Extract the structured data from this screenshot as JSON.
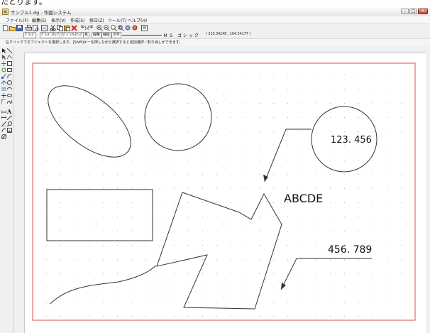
{
  "caption_top": "たとります。",
  "window": {
    "title": "サンプル1.dg - 作図システム"
  },
  "menu": [
    {
      "label": "ファイル(F)"
    },
    {
      "label": "編集(E)"
    },
    {
      "label": "表示(V)"
    },
    {
      "label": "作成(S)"
    },
    {
      "label": "修正(Z)"
    },
    {
      "label": "ツール(T)"
    },
    {
      "label": "ヘルプ(H)"
    }
  ],
  "toolbar2": {
    "grid_button": "ｸﾞﾘｯﾄﾞ",
    "grid_snap_button": "ｸﾞﾘｯﾄﾞｽﾅｯﾌﾟ",
    "object_snap_button": "ｵﾌﾞｼﾞｪｸﾄｽﾅｯﾌﾟ",
    "color_button": "色",
    "line_type_button": "線種",
    "line_width_button": "線幅",
    "text_button": "文字",
    "font_name": "ＭＳ ゴシック",
    "coords": "( 310.34248 , 164.54177 )"
  },
  "status": {
    "message": "左クリックでオブジェクトを選択します。[Shift]キーを押しながら選択すると追加選択／取り消しができます。"
  },
  "drawing": {
    "texts": {
      "circle_value": "123. 456",
      "center_text": "ABCDE",
      "leader_value": "456. 789"
    },
    "colors": {
      "border": "#e34a4a",
      "line": "#333333",
      "grid_dot": "#b8b8b8"
    }
  }
}
